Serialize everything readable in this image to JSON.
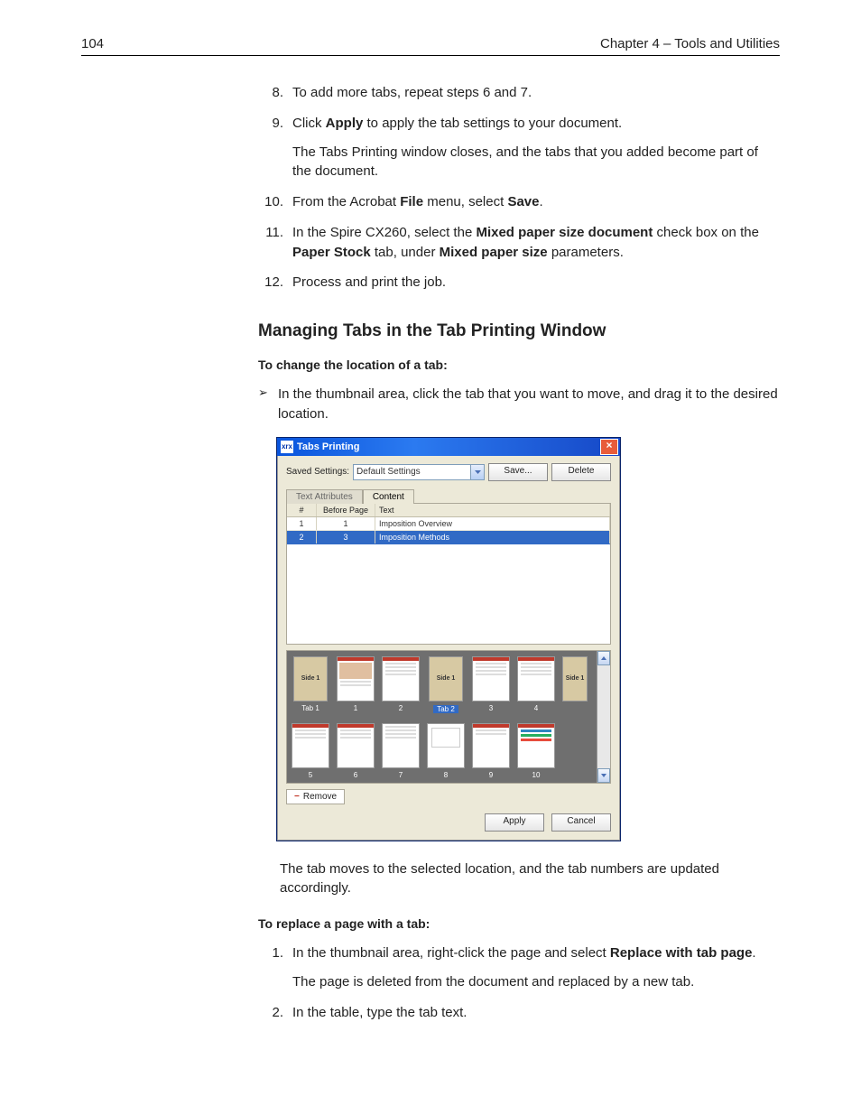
{
  "header": {
    "page_number": "104",
    "chapter": "Chapter 4 – Tools and Utilities"
  },
  "steps": {
    "s8": {
      "num": "8.",
      "text_a": "To add more tabs, repeat steps 6 and 7."
    },
    "s9": {
      "num": "9.",
      "text_a": "Click ",
      "bold_a": "Apply",
      "text_b": " to apply the tab settings to your document.",
      "para2": "The Tabs Printing window closes, and the tabs that you added become part of the document."
    },
    "s10": {
      "num": "10.",
      "text_a": "From the Acrobat ",
      "bold_a": "File",
      "text_b": " menu, select ",
      "bold_b": "Save",
      "text_c": "."
    },
    "s11": {
      "num": "11.",
      "text_a": "In the Spire CX260, select the ",
      "bold_a": "Mixed paper size document",
      "text_b": " check box on the ",
      "bold_b": "Paper Stock",
      "text_c": " tab, under ",
      "bold_c": "Mixed paper size",
      "text_d": " parameters."
    },
    "s12": {
      "num": "12.",
      "text_a": "Process and print the job."
    }
  },
  "section_heading": "Managing Tabs in the Tab Printing Window",
  "change_loc": {
    "label": "To change the location of a tab:",
    "bullet": "In the thumbnail area, click the tab that you want to move, and drag it to the desired location."
  },
  "dialog": {
    "title": "Tabs Printing",
    "app_abbr": "xrx",
    "saved_settings_label": "Saved Settings:",
    "dropdown_value": "Default Settings",
    "save_btn": "Save...",
    "delete_btn": "Delete",
    "tabs": {
      "text_attributes": "Text Attributes",
      "content": "Content"
    },
    "grid": {
      "h_num": "#",
      "h_before": "Before Page",
      "h_text": "Text",
      "rows": [
        {
          "num": "1",
          "before": "1",
          "text": "Imposition Overview",
          "selected": false
        },
        {
          "num": "2",
          "before": "3",
          "text": "Imposition Methods",
          "selected": true
        }
      ]
    },
    "thumbs": {
      "row1": [
        {
          "label": "Tab 1",
          "side": "Side 1",
          "is_tab": true
        },
        {
          "label": "1",
          "is_tab": false
        },
        {
          "label": "2",
          "is_tab": false
        },
        {
          "label": "Tab 2",
          "side": "Side 1",
          "is_tab": true,
          "highlighted": true
        },
        {
          "label": "3",
          "is_tab": false
        },
        {
          "label": "4",
          "is_tab": false
        }
      ],
      "row1_extra_side": "Side 1",
      "row2": [
        {
          "label": "5"
        },
        {
          "label": "6"
        },
        {
          "label": "7"
        },
        {
          "label": "8"
        },
        {
          "label": "9"
        },
        {
          "label": "10"
        }
      ]
    },
    "remove_btn": "Remove",
    "apply_btn": "Apply",
    "cancel_btn": "Cancel"
  },
  "after_dialog_para": "The tab moves to the selected location, and the tab numbers are updated accordingly.",
  "replace": {
    "label": "To replace a page with a tab:",
    "s1": {
      "num": "1.",
      "text_a": "In the thumbnail area, right-click the page and select ",
      "bold_a": "Replace with tab page",
      "text_b": ".",
      "para2": "The page is deleted from the document and replaced by a new tab."
    },
    "s2": {
      "num": "2.",
      "text_a": "In the table, type the tab text."
    }
  }
}
